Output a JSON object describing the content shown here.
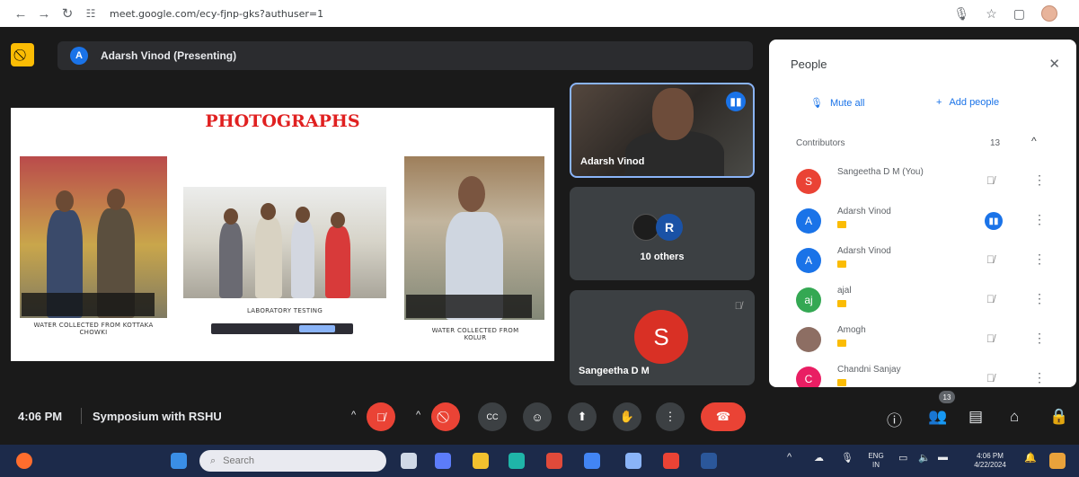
{
  "browser": {
    "back_icon": "arrow-left",
    "forward_icon": "arrow-right",
    "reload_icon": "reload",
    "url": "meet.google.com/ecy-fjnp-gks?authuser=1"
  },
  "meet": {
    "presenter_initial": "A",
    "presenting_label": "Adarsh Vinod (Presenting)",
    "slide": {
      "title": "PHOTOGRAPHS",
      "caption_1": "WATER COLLECTED FROM KOTTAKA CHOWKI",
      "caption_2": "LABORATORY TESTING",
      "caption_3": "WATER COLLECTED FROM KOLUR"
    },
    "tiles": [
      {
        "name": "Adarsh Vinod"
      },
      {
        "initial": "R",
        "label": "10 others"
      },
      {
        "initial": "S",
        "name": "Sangeetha D M"
      }
    ],
    "clock": "4:06 PM",
    "meeting_name": "Symposium with RSHU",
    "participant_count": "13",
    "colors": {
      "accent": "#1a73e8",
      "danger": "#ea4335",
      "presenter_badge": "#fbbc04"
    }
  },
  "people_panel": {
    "title": "People",
    "mute_all": "Mute all",
    "add_people": "Add people",
    "section_label": "Contributors",
    "section_count": "13",
    "people": [
      {
        "initial": "S",
        "name": "Sangeetha D M (You)",
        "color": "#ea4335"
      },
      {
        "initial": "A",
        "name": "Adarsh Vinod",
        "color": "#1a73e8"
      },
      {
        "initial": "A",
        "name": "Adarsh Vinod",
        "color": "#1a73e8"
      },
      {
        "initial": "aj",
        "name": "ajal",
        "color": "#34a853"
      },
      {
        "initial": "",
        "name": "Amogh",
        "color": "#8d6e63"
      },
      {
        "initial": "C",
        "name": "Chandni Sanjay",
        "color": "#e91e63"
      }
    ]
  },
  "taskbar": {
    "search_placeholder": "Search",
    "lang_top": "ENG",
    "lang_bottom": "IN",
    "time": "4:06 PM",
    "date": "4/22/2024"
  }
}
